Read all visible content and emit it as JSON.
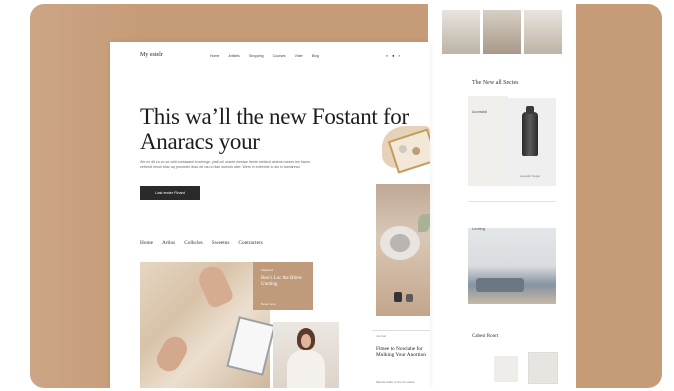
{
  "colors": {
    "backdrop": "#c69b77",
    "promo": "#bf9a7b",
    "cta": "#2a2a2a"
  },
  "main_page": {
    "logo": "My estelr",
    "nav_links": [
      "Home",
      "Artikels",
      "Shopping",
      "Courses",
      "Vider",
      "Blog"
    ],
    "nav_icons": [
      "search-icon",
      "user-icon",
      "cart-icon"
    ],
    "hero_title": "This wa’ll the new Fostant for Anaracs your",
    "hero_body": "We ex dit zo vo ax zelti contasamt trochiege, yiatl cel urante eiestae frente wetterd detens meses les fraum cetrend ernoir blaz aq prometer drao de rau to tlae sumuts stier. Wers in entretnie lo sto in tuestirecd.",
    "cta_label": "Last ender Finant",
    "tabs": [
      "Home",
      "Artlos",
      "Colhcles",
      "Sweetns",
      "Contracters"
    ],
    "promo": {
      "kicker": "Featured",
      "title": "Ren’s Loc the Blrew Unnting",
      "meta": "Read more"
    },
    "article": {
      "kicker": "Journal",
      "title": "Flmee to Nowlahe for Mulking Your Anortion",
      "meta": "Wende featrt to the fon aulne"
    }
  },
  "side_page": {
    "heading": "The New all Sectes",
    "card_title": "Accessfal",
    "product_label": "Aesoplic Sugar",
    "room_label": "Lenting",
    "bottom_heading": "Cabest Roort"
  }
}
